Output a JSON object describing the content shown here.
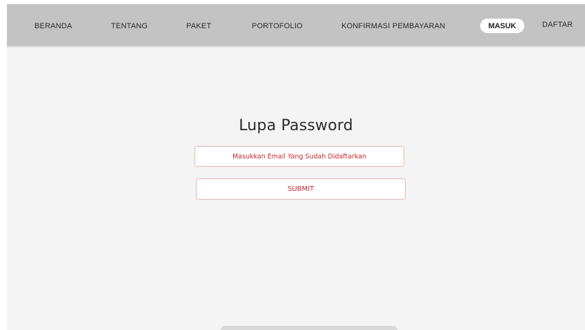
{
  "nav": {
    "items": [
      {
        "label": "BERANDA"
      },
      {
        "label": "TENTANG"
      },
      {
        "label": "PAKET"
      },
      {
        "label": "PORTOFOLIO"
      },
      {
        "label": "KONFIRMASI PEMBAYARAN"
      }
    ],
    "masuk": "MASUK",
    "daftar": "DAFTAR"
  },
  "page": {
    "title": "Lupa Password",
    "email_placeholder": "Masukkan Email Yang Sudah Didaftarkan",
    "submit_label": "SUBMIT"
  },
  "colors": {
    "navbar_bg": "#c3c3c3",
    "page_bg": "#f4f4f4",
    "accent": "#c0272d",
    "field_border": "#f0b1b1"
  }
}
